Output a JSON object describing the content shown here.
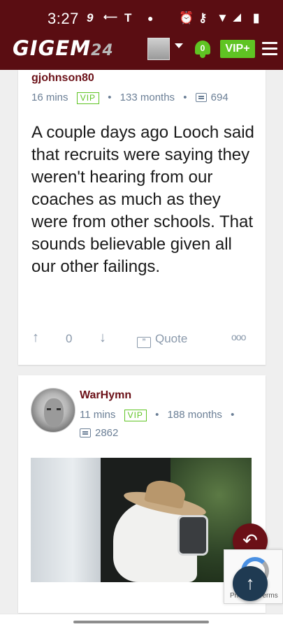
{
  "status_bar": {
    "time": "3:27",
    "icons": [
      "nine-icon",
      "arrow-icon",
      "t-mobile-icon",
      "dot-icon",
      "alarm-icon",
      "key-icon",
      "wifi-icon",
      "signal-icon",
      "battery-icon"
    ],
    "glyph_9": "9",
    "glyph_t": "T"
  },
  "header": {
    "brand": "GIGEM",
    "brand_num": "24",
    "notification_count": "0",
    "vip_label": "VIP+"
  },
  "posts": [
    {
      "username": "gjohnson80",
      "time": "16 mins",
      "badge": "VIP",
      "tenure": "133 months",
      "comments": "694",
      "body": "A couple days ago Looch said that recruits were saying they weren't hearing from our coaches as much as they were from other schools. That sounds believable given all our other failings.",
      "vote_count": "0",
      "quote_label": "Quote",
      "more": "ooo"
    },
    {
      "username": "WarHymn",
      "time": "11 mins",
      "badge": "VIP",
      "tenure": "188 months",
      "comments": "2862"
    }
  ],
  "recaptcha": {
    "text": "Privacy - Terms"
  },
  "colors": {
    "header_bg": "#5a0d12",
    "accent_green": "#5fc423",
    "username": "#6b1017",
    "meta": "#6b7f96"
  }
}
